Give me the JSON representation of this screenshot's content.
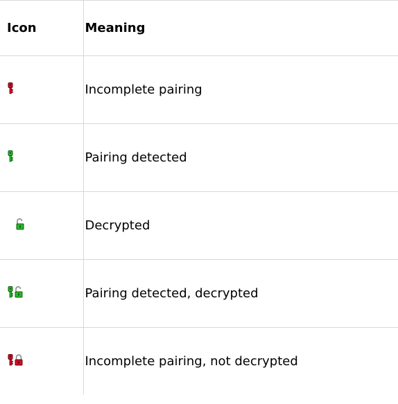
{
  "table": {
    "headers": {
      "icon": "Icon",
      "meaning": "Meaning"
    },
    "rows": [
      {
        "icons": [
          "red-key-icon"
        ],
        "meaning": "Incomplete pairing"
      },
      {
        "icons": [
          "green-key-icon"
        ],
        "meaning": "Pairing detected"
      },
      {
        "icons": [
          "green-unlocked-padlock-icon"
        ],
        "meaning": "Decrypted"
      },
      {
        "icons": [
          "green-key-icon",
          "green-unlocked-padlock-icon"
        ],
        "meaning": "Pairing detected, decrypted"
      },
      {
        "icons": [
          "red-key-icon",
          "red-locked-padlock-icon"
        ],
        "meaning": "Incomplete pairing, not decrypted"
      }
    ]
  },
  "colors": {
    "red": "#c8102e",
    "red_dark": "#6e0000",
    "green": "#2db52d",
    "green_dark": "#0b5e0b",
    "border": "#d7d7d7"
  }
}
